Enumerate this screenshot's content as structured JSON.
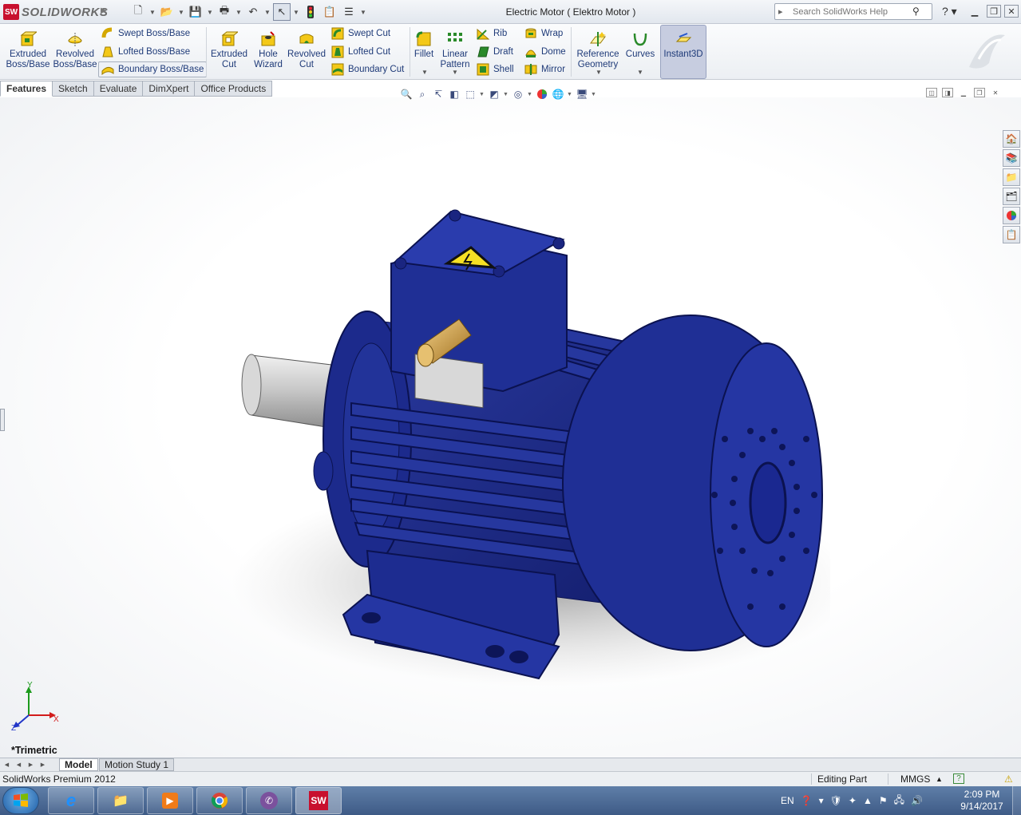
{
  "app": {
    "brand": "SOLIDWORKS",
    "window_title": "Electric Motor ( Elektro Motor )",
    "search_placeholder": "Search SolidWorks Help"
  },
  "ribbon": {
    "extruded_boss": "Extruded\nBoss/Base",
    "revolved_boss": "Revolved\nBoss/Base",
    "swept_boss": "Swept Boss/Base",
    "lofted_boss": "Lofted Boss/Base",
    "boundary_boss": "Boundary Boss/Base",
    "extruded_cut": "Extruded\nCut",
    "hole_wizard": "Hole\nWizard",
    "revolved_cut": "Revolved\nCut",
    "swept_cut": "Swept Cut",
    "lofted_cut": "Lofted Cut",
    "boundary_cut": "Boundary Cut",
    "fillet": "Fillet",
    "linear_pattern": "Linear\nPattern",
    "rib": "Rib",
    "draft": "Draft",
    "shell": "Shell",
    "wrap": "Wrap",
    "dome": "Dome",
    "mirror": "Mirror",
    "reference_geometry": "Reference\nGeometry",
    "curves": "Curves",
    "instant3d": "Instant3D"
  },
  "tabs": [
    "Features",
    "Sketch",
    "Evaluate",
    "DimXpert",
    "Office Products"
  ],
  "viewport": {
    "view_name": "*Trimetric",
    "triad": {
      "x": "X",
      "y": "Y",
      "z": "Z"
    }
  },
  "bottom_tabs": [
    "Model",
    "Motion Study 1"
  ],
  "status": {
    "product": "SolidWorks Premium 2012",
    "mode": "Editing Part",
    "units": "MMGS"
  },
  "taskbar": {
    "language": "EN",
    "time": "2:09 PM",
    "date": "9/14/2017"
  },
  "colors": {
    "motor_blue": "#1e2f8c",
    "accent": "#c8102e",
    "taskbar": "#3e5b86"
  }
}
